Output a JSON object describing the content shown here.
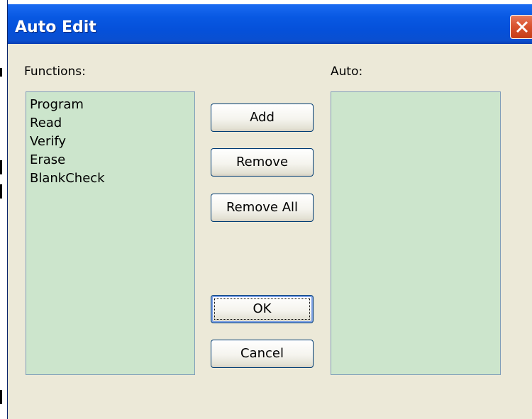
{
  "window": {
    "title": "Auto Edit"
  },
  "labels": {
    "functions": "Functions:",
    "auto": "Auto:"
  },
  "functions_list": {
    "items": [
      "Program",
      "Read",
      "Verify",
      "Erase",
      "BlankCheck"
    ]
  },
  "auto_list": {
    "items": []
  },
  "buttons": {
    "add": "Add",
    "remove": "Remove",
    "remove_all": "Remove All",
    "ok": "OK",
    "cancel": "Cancel"
  },
  "colors": {
    "titlebar": "#0858e2",
    "dialog_bg": "#ece9d8",
    "listbox_bg": "#cce5cc",
    "close_button": "#d9532f"
  }
}
